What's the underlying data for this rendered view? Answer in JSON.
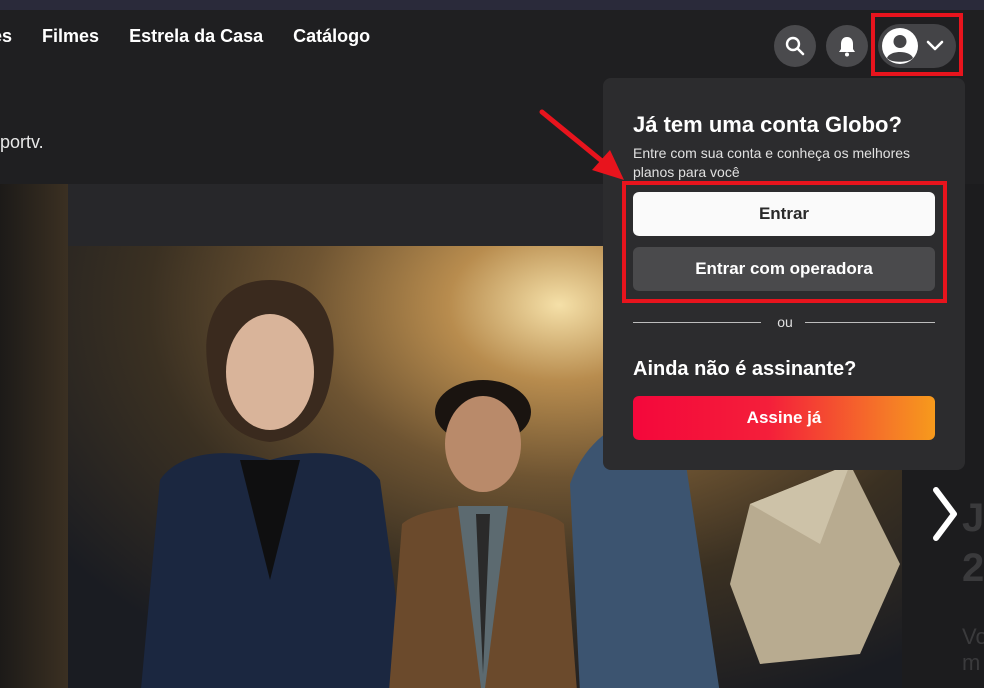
{
  "nav": {
    "items": [
      "es",
      "Filmes",
      "Estrela da Casa",
      "Catálogo"
    ]
  },
  "subheader": {
    "text": "portv."
  },
  "header_icons": {
    "search": "search-icon",
    "bell": "bell-icon",
    "profile": "user-avatar-icon",
    "chevron": "chevron-down-icon"
  },
  "dropdown": {
    "title": "Já tem uma conta Globo?",
    "subtitle": "Entre com sua conta e conheça os melhores planos para você",
    "login_button": "Entrar",
    "operator_button": "Entrar com operadora",
    "divider_text": "ou",
    "subscribe_title": "Ainda não é assinante?",
    "subscribe_button": "Assine já"
  },
  "side_ghost": {
    "line1": "Je",
    "line2": "2",
    "line3": "Vo\nm"
  },
  "colors": {
    "highlight_red": "#e8141d",
    "subscribe_gradient_start": "#f4073b",
    "subscribe_gradient_end": "#f79a1c",
    "panel_bg": "#2c2c2e"
  }
}
